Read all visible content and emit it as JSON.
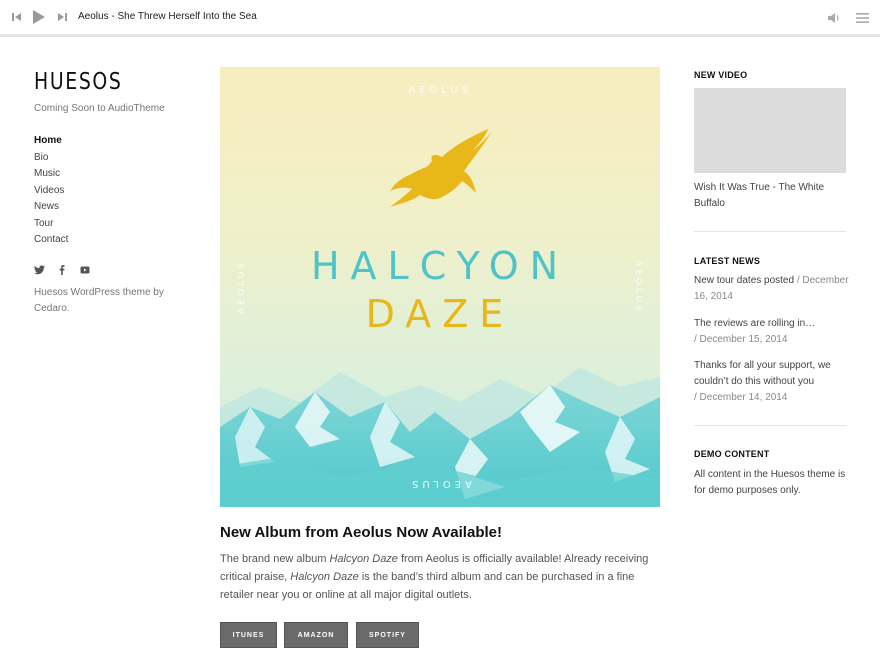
{
  "player": {
    "track_title": "Aeolus - She Threw Herself Into the Sea"
  },
  "site": {
    "title": "HUESOS",
    "tagline": "Coming Soon to AudioTheme",
    "credit": "Huesos WordPress theme by Cedaro."
  },
  "nav": {
    "items": [
      {
        "label": "Home"
      },
      {
        "label": "Bio"
      },
      {
        "label": "Music"
      },
      {
        "label": "Videos"
      },
      {
        "label": "News"
      },
      {
        "label": "Tour"
      },
      {
        "label": "Contact"
      }
    ]
  },
  "social": [
    "twitter-icon",
    "facebook-icon",
    "youtube-icon"
  ],
  "album_art": {
    "band_top": "AEOLUS",
    "band_left": "AEOLUS",
    "band_right": "AEOLUS",
    "band_bottom": "AEOLUS",
    "title_line1": "HALCYON",
    "title_line2": "DAZE",
    "accent_cyan": "#4fc3c9",
    "accent_gold": "#e8b71a"
  },
  "post": {
    "title": "New Album from Aeolus Now Available!",
    "body_1": "The brand new album ",
    "body_album_1": "Halcyon Daze",
    "body_2": " from Aeolus is officially available! Already receiving critical praise, ",
    "body_album_2": "Halcyon Daze",
    "body_3": " is the band’s third album and can be purchased in a fine retailer near you or online at all major digital outlets.",
    "buttons": [
      {
        "label": "ITUNES"
      },
      {
        "label": "AMAZON"
      },
      {
        "label": "SPOTIFY"
      }
    ]
  },
  "sidebar": {
    "new_video": {
      "heading": "NEW VIDEO",
      "caption": "Wish It Was True - The White Buffalo"
    },
    "latest_news": {
      "heading": "LATEST NEWS",
      "items": [
        {
          "title": "New tour dates posted",
          "date": " / December 16, 2014"
        },
        {
          "title": "The reviews are rolling in…",
          "date": "/ December 15, 2014"
        },
        {
          "title": "Thanks for all your support, we couldn’t do this without you",
          "date": "/ December 14, 2014"
        }
      ]
    },
    "demo": {
      "heading": "DEMO CONTENT",
      "text": "All content in the Huesos theme is for demo purposes only."
    }
  }
}
